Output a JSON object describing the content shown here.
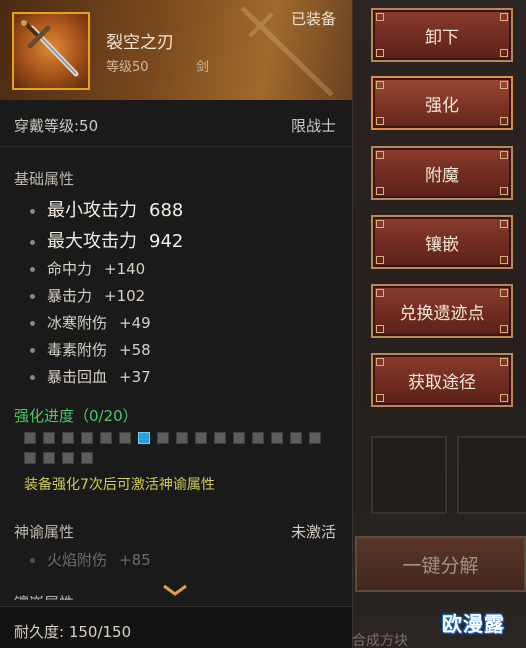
{
  "item": {
    "name": "裂空之刃",
    "level": "等级50",
    "type": "剑",
    "equipped": "已装备",
    "icon": "sword-icon"
  },
  "requirements": {
    "level": "穿戴等级:50",
    "class": "限战士"
  },
  "base_attributes": {
    "title": "基础属性",
    "stats": [
      {
        "name": "最小攻击力",
        "value": "688"
      },
      {
        "name": "最大攻击力",
        "value": "942"
      },
      {
        "name": "命中力",
        "value": "+140"
      },
      {
        "name": "暴击力",
        "value": "+102"
      },
      {
        "name": "冰寒附伤",
        "value": "+49"
      },
      {
        "name": "毒素附伤",
        "value": "+58"
      },
      {
        "name": "暴击回血",
        "value": "+37"
      }
    ]
  },
  "enhancement": {
    "title": "强化进度（0/20）",
    "total": 20,
    "highlighted_index": 6,
    "note": "装备强化7次后可激活神谕属性"
  },
  "oracle": {
    "title": "神谕属性",
    "status": "未激活",
    "stat_name": "火焰附伤",
    "stat_value": "+85"
  },
  "socket_title": "镶嵌属性",
  "durability": "耐久度:  150/150",
  "buttons": [
    {
      "label": "卸下"
    },
    {
      "label": "强化"
    },
    {
      "label": "附魔"
    },
    {
      "label": "镶嵌"
    },
    {
      "label": "兑换遗迹点"
    },
    {
      "label": "获取途径"
    }
  ],
  "decompose": "一键分解",
  "synthesize": "合成方块",
  "watermark": "欧漫露",
  "colors": {
    "accent_gold": "#e6a21c",
    "enhance_green": "#4fc66a",
    "note_yellow": "#d0cc5c",
    "button_red": "#6e2a20"
  }
}
